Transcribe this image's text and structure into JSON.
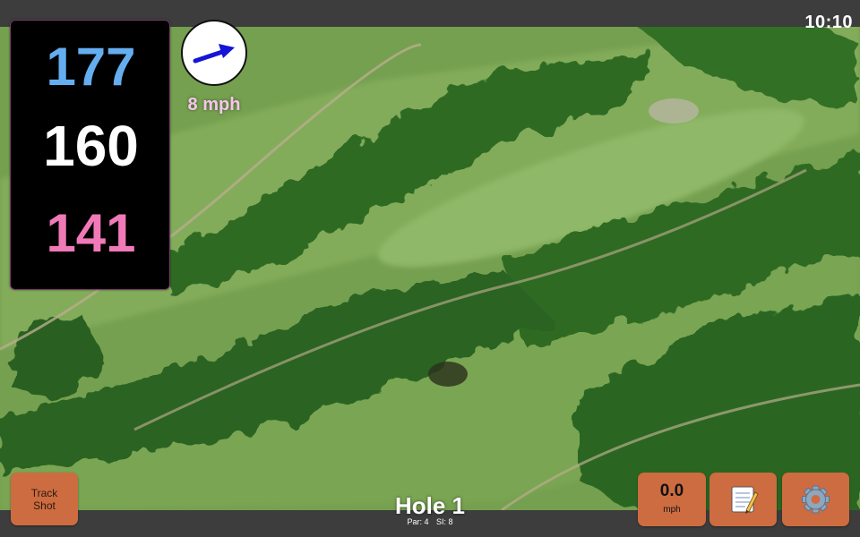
{
  "status_bar": {
    "time": "10:10"
  },
  "yardages": {
    "back": "177",
    "center": "160",
    "front": "141",
    "colors": {
      "back": "#64aef0",
      "center": "#ffffff",
      "front": "#f07ab8"
    }
  },
  "wind": {
    "speed": "8 mph",
    "arrow_color": "#1515d6",
    "text_color": "#f6c6ec"
  },
  "track_button": {
    "line1": "Track",
    "line2": "Shot"
  },
  "hole": {
    "title": "Hole 1",
    "par": "Par: 4",
    "stroke_index": "SI: 8"
  },
  "speed_button": {
    "value": "0.0",
    "unit": "mph"
  },
  "icons": {
    "notes": "notepad-icon",
    "settings": "gear-icon",
    "wind": "wind-arrow-icon"
  },
  "colors": {
    "button": "#cd6c40",
    "bar": "#3d3d3d"
  }
}
